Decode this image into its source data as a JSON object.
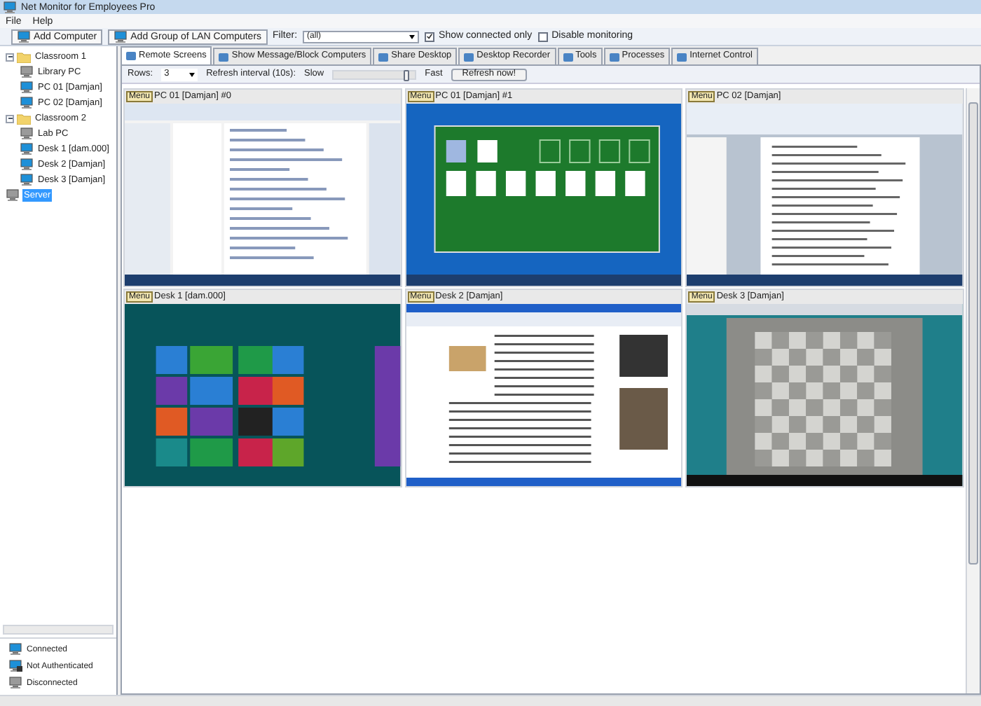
{
  "window": {
    "title": "Net Monitor for Employees Pro"
  },
  "menu": [
    "File",
    "Help"
  ],
  "toolbar": {
    "add_computer": "Add Computer",
    "add_group": "Add Group of LAN Computers",
    "filter_label": "Filter:",
    "filter_value": "(all)",
    "options": [
      {
        "label": "Show connected only",
        "checked": true
      },
      {
        "label": "Disable monitoring",
        "checked": false
      }
    ]
  },
  "tree": [
    {
      "label": "Classroom 1",
      "kind": "folder",
      "expanded": true,
      "selected": false,
      "children": [
        {
          "label": "Library PC",
          "kind": "computer",
          "connected": false,
          "selected": false
        },
        {
          "label": "PC 01 [Damjan]",
          "kind": "computer",
          "connected": true,
          "selected": false
        },
        {
          "label": "PC 02 [Damjan]",
          "kind": "computer",
          "connected": true,
          "selected": false
        }
      ]
    },
    {
      "label": "Classroom 2",
      "kind": "folder",
      "expanded": true,
      "selected": false,
      "children": [
        {
          "label": "Lab PC",
          "kind": "computer",
          "connected": false,
          "selected": false
        },
        {
          "label": "Desk 1 [dam.000]",
          "kind": "computer",
          "connected": true,
          "selected": false
        },
        {
          "label": "Desk 2 [Damjan]",
          "kind": "computer",
          "connected": true,
          "selected": false
        },
        {
          "label": "Desk 3 [Damjan]",
          "kind": "computer",
          "connected": true,
          "selected": false
        }
      ]
    },
    {
      "label": "Server",
      "kind": "computer",
      "connected": false,
      "selected": true
    }
  ],
  "legend": [
    {
      "label": "Connected",
      "kind": "connected"
    },
    {
      "label": "Not Authenticated",
      "kind": "unauthenticated"
    },
    {
      "label": "Disconnected",
      "kind": "disconnected"
    }
  ],
  "tabs": [
    {
      "label": "Remote Screens",
      "selected": true
    },
    {
      "label": "Show Message/Block Computers",
      "selected": false
    },
    {
      "label": "Share Desktop",
      "selected": false
    },
    {
      "label": "Desktop Recorder",
      "selected": false
    },
    {
      "label": "Tools",
      "selected": false
    },
    {
      "label": "Processes",
      "selected": false
    },
    {
      "label": "Internet Control",
      "selected": false
    }
  ],
  "screen_toolbar": {
    "rows_label": "Rows:",
    "rows_value": "3",
    "refresh_label": "Refresh interval (10s):",
    "slow": "Slow",
    "fast": "Fast",
    "refresh": {
      "level": 0.9
    },
    "refresh_button": "Refresh now!"
  },
  "screens": [
    {
      "menu": "Menu",
      "title": "PC 01 [Damjan] #0",
      "kind": "desktop"
    },
    {
      "menu": "Menu",
      "title": "PC 01 [Damjan] #1",
      "kind": "cards"
    },
    {
      "menu": "Menu",
      "title": "PC 02 [Damjan]",
      "kind": "document"
    },
    {
      "menu": "Menu",
      "title": "Desk 1 [dam.000]",
      "kind": "tiles"
    },
    {
      "menu": "Menu",
      "title": "Desk 2 [Damjan]",
      "kind": "browser"
    },
    {
      "menu": "Menu",
      "title": "Desk 3 [Damjan]",
      "kind": "chess"
    }
  ]
}
